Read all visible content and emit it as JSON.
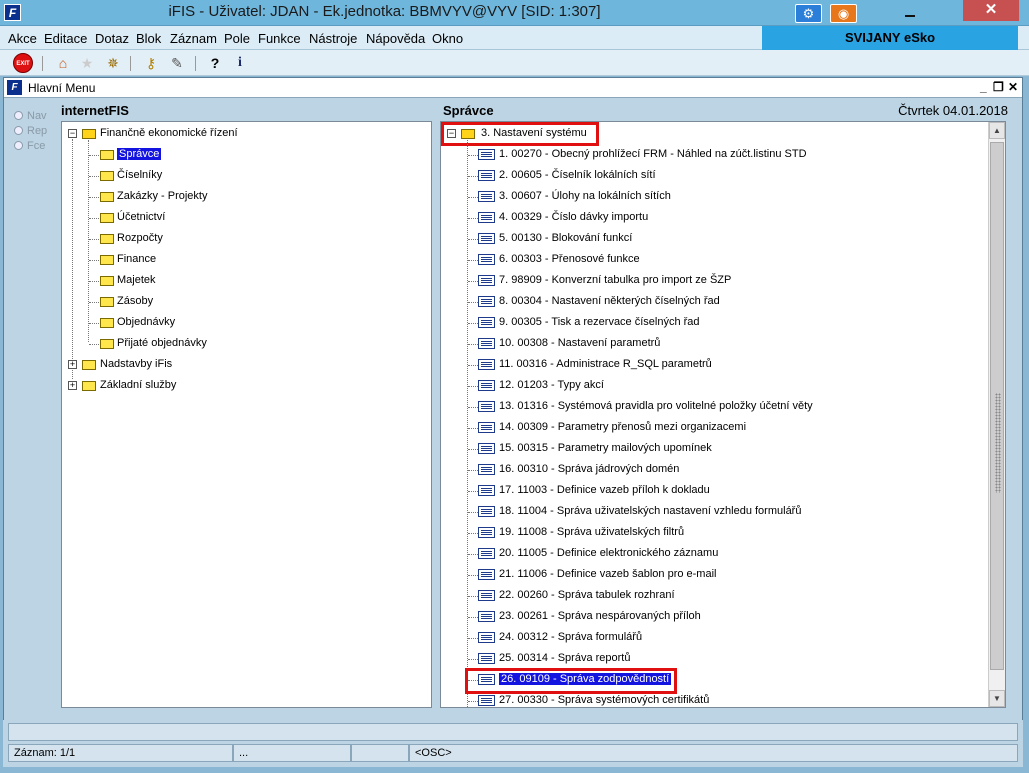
{
  "window": {
    "title": "iFIS - Uživatel: JDAN - Ek.jednotka: BBMVYV@VYV   [SID: 1:307]",
    "app_icon": "F",
    "brand": "SVIJANY eSko"
  },
  "menu": [
    "Akce",
    "Editace",
    "Dotaz",
    "Blok",
    "Záznam",
    "Pole",
    "Funkce",
    "Nástroje",
    "Nápověda",
    "Okno"
  ],
  "toolbar": {
    "exit_label": "EXIT"
  },
  "inner_window": {
    "title": "Hlavní Menu",
    "icon": "F"
  },
  "radios": [
    "Nav",
    "Rep",
    "Fce"
  ],
  "left_pane": {
    "header": "internetFIS",
    "root": "Finančně ekonomické řízení",
    "children": [
      "Správce",
      "Číselníky",
      "Zakázky - Projekty",
      "Účetnictví",
      "Rozpočty",
      "Finance",
      "Majetek",
      "Zásoby",
      "Objednávky",
      "Přijaté objednávky"
    ],
    "selected_index": 0,
    "others": [
      "Nadstavby iFis",
      "Základní služby"
    ]
  },
  "right_pane": {
    "header": "Správce",
    "date": "Čtvrtek 04.01.2018",
    "root": "3.  Nastavení systému",
    "items": [
      "1.  00270 - Obecný prohlížecí FRM - Náhled na zúčt.listinu STD",
      "2.  00605 - Číselník lokálních sítí",
      "3.  00607 - Úlohy na lokálních sítích",
      "4.  00329 - Číslo dávky importu",
      "5.  00130 - Blokování funkcí",
      "6.  00303 - Přenosové funkce",
      "7.  98909 - Konverzní tabulka pro import ze ŠZP",
      "8.  00304 - Nastavení některých číselných řad",
      "9.  00305 - Tisk a rezervace číselných řad",
      "10. 00308 - Nastavení parametrů",
      "11. 00316 - Administrace R_SQL parametrů",
      "12. 01203 - Typy akcí",
      "13. 01316 - Systémová pravidla pro volitelné položky účetní věty",
      "14. 00309 - Parametry přenosů mezi organizacemi",
      "15. 00315 - Parametry mailových upomínek",
      "16. 00310 - Správa jádrových domén",
      "17. 11003 - Definice vazeb příloh k dokladu",
      "18. 11004 - Správa uživatelských nastavení vzhledu formulářů",
      "19. 11008 - Správa uživatelských filtrů",
      "20. 11005 - Definice elektronického záznamu",
      "21. 11006 - Definice vazeb šablon pro e-mail",
      "22. 00260 - Správa tabulek rozhraní",
      "23. 00261 - Správa nespárovaných příloh",
      "24. 00312 - Správa formulářů",
      "25. 00314 - Správa reportů",
      "26. 09109 - Správa zodpovědností",
      "27. 00330 - Správa systémových certifikátů"
    ],
    "selected_index": 25
  },
  "status": {
    "record": "Záznam: 1/1",
    "ellipsis": "...",
    "osc": "<OSC>"
  },
  "colors": {
    "highlight": "#e01010",
    "selection": "#1414e0",
    "brand_bg": "#2aa3e3"
  }
}
